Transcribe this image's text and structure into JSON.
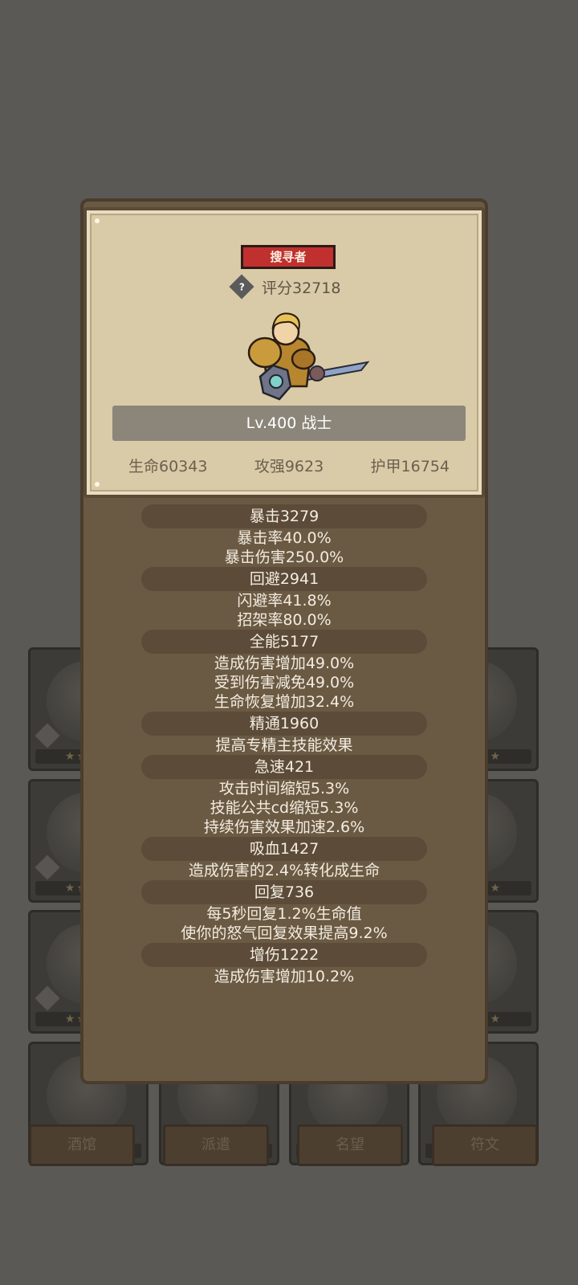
{
  "background": {
    "bottom_tabs": [
      "酒馆",
      "派遣",
      "名望",
      "符文"
    ],
    "card_stars": "★★★★"
  },
  "popup": {
    "class_tag": "搜寻者",
    "score": "评分32718",
    "help_icon_label": "?",
    "level": "Lv.400 战士",
    "base_stats": [
      "生命60343",
      "攻强9623",
      "护甲16754"
    ],
    "stats": [
      {
        "head": "暴击3279",
        "lines": [
          "暴击率40.0%",
          "暴击伤害250.0%"
        ]
      },
      {
        "head": "回避2941",
        "lines": [
          "闪避率41.8%",
          "招架率80.0%"
        ]
      },
      {
        "head": "全能5177",
        "lines": [
          "造成伤害增加49.0%",
          "受到伤害减免49.0%",
          "生命恢复增加32.4%"
        ]
      },
      {
        "head": "精通1960",
        "lines": [
          "提高专精主技能效果"
        ]
      },
      {
        "head": "急速421",
        "lines": [
          "攻击时间缩短5.3%",
          "技能公共cd缩短5.3%",
          "持续伤害效果加速2.6%"
        ]
      },
      {
        "head": "吸血1427",
        "lines": [
          "造成伤害的2.4%转化成生命"
        ]
      },
      {
        "head": "回复736",
        "lines": [
          "每5秒回复1.2%生命值",
          "使你的怒气回复效果提高9.2%"
        ]
      },
      {
        "head": "增伤1222",
        "lines": [
          "造成伤害增加10.2%"
        ]
      }
    ]
  },
  "colors": {
    "badge_red": "#c0302f",
    "parchment": "#d9cba8",
    "panel_brown": "#6b5a43"
  }
}
